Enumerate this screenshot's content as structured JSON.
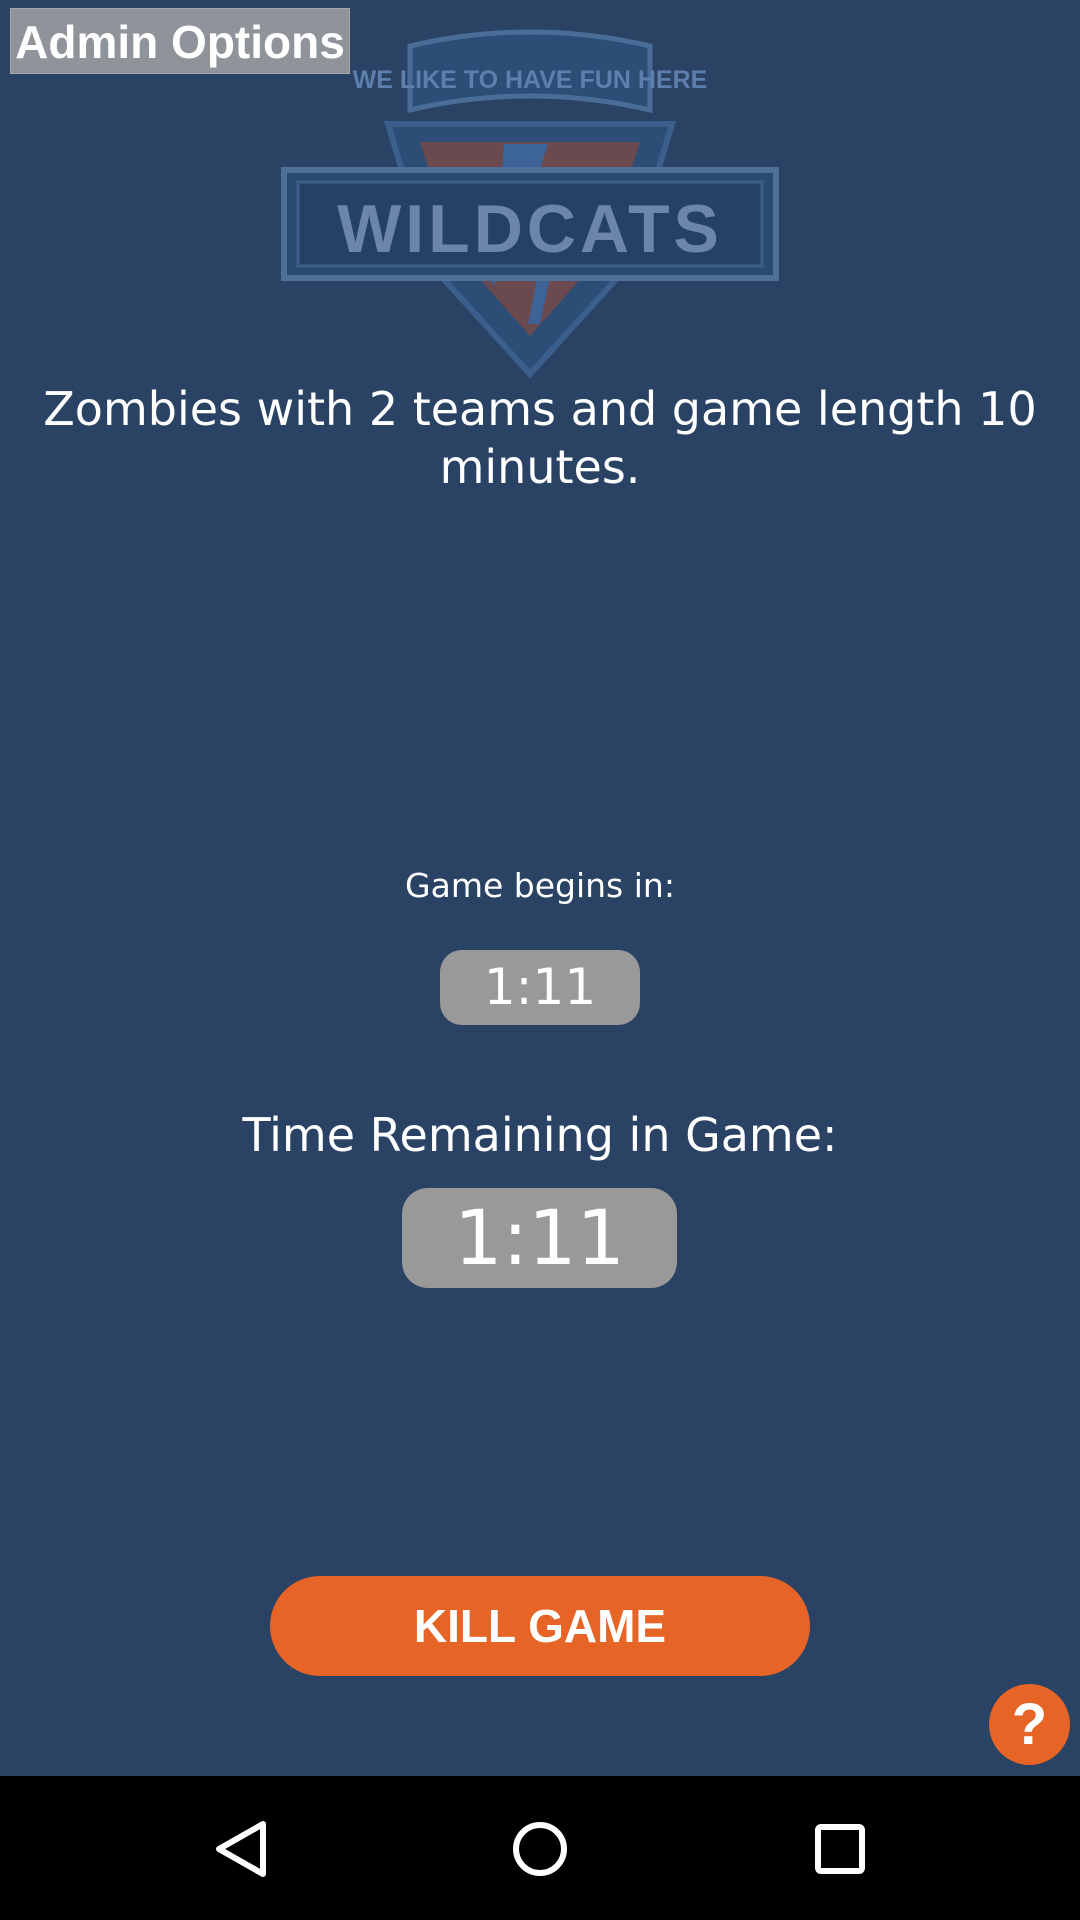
{
  "header": {
    "admin_options_label": "Admin Options"
  },
  "logo": {
    "name": "wildcats-logo",
    "banner_text": "WE LIKE TO HAVE FUN HERE",
    "wordmark": "WILDCATS"
  },
  "game": {
    "summary": "Zombies  with 2 teams and game length 10 minutes.",
    "begins_label": "Game begins in:",
    "begins_timer": "1:11",
    "remaining_label": "Time Remaining in Game:",
    "remaining_timer": "1:11"
  },
  "actions": {
    "kill_game_label": "KILL GAME",
    "help_label": "?"
  },
  "nav_bar": {
    "icons": [
      "back-icon",
      "home-icon",
      "recents-icon"
    ]
  },
  "colors": {
    "background": "#2a4263",
    "accent": "#e76427",
    "timer_pill": "#999999",
    "admin_button": "#8f939a",
    "nav_bar": "#000000"
  }
}
